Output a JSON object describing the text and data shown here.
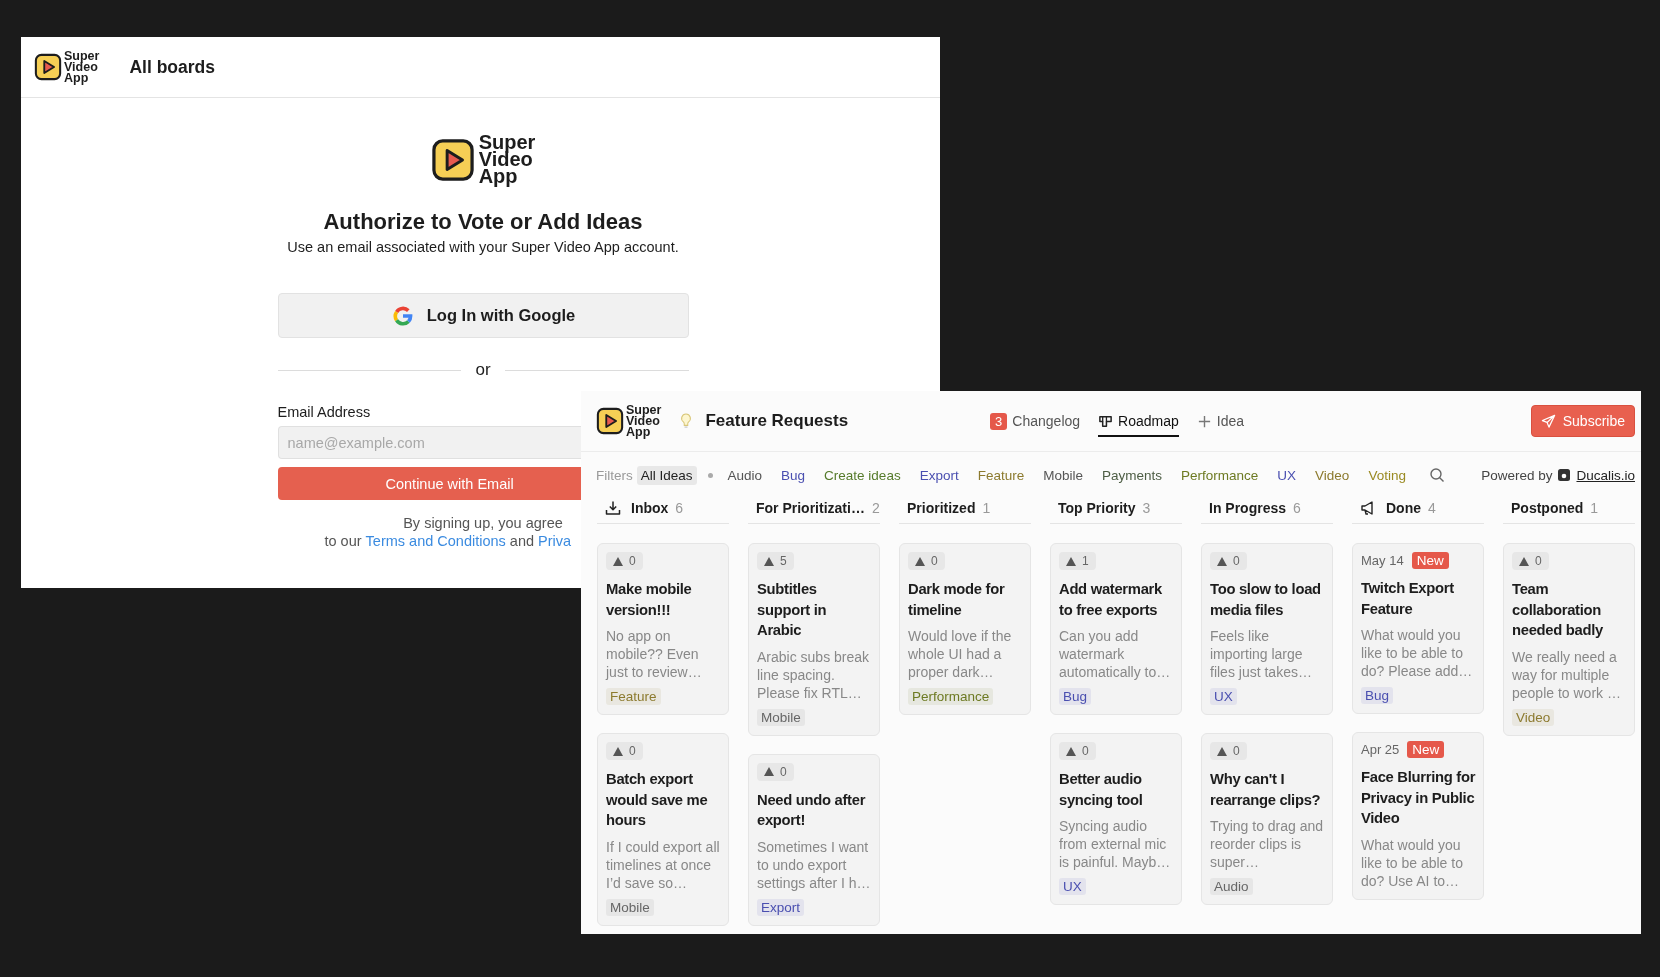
{
  "login_window": {
    "logo_text": "Super Video App",
    "title": "All boards",
    "hero_logo_text": "Super Video App",
    "heading": "Authorize to Vote or Add Ideas",
    "subheading": "Use an email associated with your Super Video App account.",
    "google_button": "Log In with Google",
    "divider": "or",
    "email_label": "Email Address",
    "email_placeholder": "name@example.com",
    "continue_button": "Continue with Email",
    "legal_line_1": "By signing up, you agree",
    "legal_line_2": {
      "prefix": "to our",
      "link": "Terms and Conditions",
      "middle": "and",
      "cut_link": "Priva"
    }
  },
  "board_window": {
    "logo_text": "Super Video App",
    "title": "Feature Requests",
    "nav": [
      {
        "label": "Changelog",
        "badge": "3",
        "selected": false
      },
      {
        "label": "Roadmap",
        "selected": true
      },
      {
        "label": "Idea",
        "selected": false
      }
    ],
    "subscribe_button": "Subscribe",
    "filters_label": "Filters",
    "filters": [
      {
        "label": "All Ideas",
        "selected": true,
        "color": "#222222"
      },
      {
        "label": "Audio",
        "selected": false,
        "color": "#555555"
      },
      {
        "label": "Bug",
        "selected": false,
        "color": "#4a4fb0"
      },
      {
        "label": "Create ideas",
        "selected": false,
        "color": "#557a2a"
      },
      {
        "label": "Export",
        "selected": false,
        "color": "#4a4fb0"
      },
      {
        "label": "Feature",
        "selected": false,
        "color": "#8c7a2e"
      },
      {
        "label": "Mobile",
        "selected": false,
        "color": "#555555"
      },
      {
        "label": "Payments",
        "selected": false,
        "color": "#4d5d44"
      },
      {
        "label": "Performance",
        "selected": false,
        "color": "#6d7a22"
      },
      {
        "label": "UX",
        "selected": false,
        "color": "#4a4fb0"
      },
      {
        "label": "Video",
        "selected": false,
        "color": "#8c7a2e"
      },
      {
        "label": "Voting",
        "selected": false,
        "color": "#9a8a22"
      }
    ],
    "powered_by": "Powered by",
    "powered_link": "Ducalis.io",
    "columns": [
      {
        "name": "Inbox",
        "count": "6",
        "cards": [
          {
            "kind": "idea",
            "votes": "0",
            "title": "Make mobile version!!!",
            "description": "No app on mobile?? Even just to review…",
            "tag": {
              "label": "Feature",
              "color": "#8c7a2e"
            }
          },
          {
            "kind": "idea",
            "votes": "0",
            "title": "Batch export would save me hours",
            "description": "If I could export all timelines at once I’d save so…",
            "tag": {
              "label": "Mobile",
              "color": "#666666"
            }
          }
        ]
      },
      {
        "name": "For Prioritizati…",
        "count": "2",
        "cards": [
          {
            "kind": "idea",
            "votes": "5",
            "title": "Subtitles support in Arabic",
            "description": "Arabic subs break line spacing. Please fix RTL…",
            "tag": {
              "label": "Mobile",
              "color": "#666666"
            }
          },
          {
            "kind": "idea",
            "votes": "0",
            "title": "Need undo after export!",
            "description": "Sometimes I want to undo export settings after I h…",
            "tag": {
              "label": "Export",
              "color": "#4a4fb0"
            }
          }
        ]
      },
      {
        "name": "Prioritized",
        "count": "1",
        "cards": [
          {
            "kind": "idea",
            "votes": "0",
            "title": "Dark mode for timeline",
            "description": "Would love if the whole UI had a proper dark…",
            "tag": {
              "label": "Performance",
              "color": "#6d7a22"
            }
          }
        ]
      },
      {
        "name": "Top Priority",
        "count": "3",
        "cards": [
          {
            "kind": "idea",
            "votes": "1",
            "title": "Add watermark to free exports",
            "description": "Can you add watermark automatically to…",
            "tag": {
              "label": "Bug",
              "color": "#4a4fb0"
            }
          },
          {
            "kind": "idea",
            "votes": "0",
            "title": "Better audio syncing tool",
            "description": "Syncing audio from external mic is painful. Mayb…",
            "tag": {
              "label": "UX",
              "color": "#4a4fb0"
            }
          }
        ]
      },
      {
        "name": "In Progress",
        "count": "6",
        "cards": [
          {
            "kind": "idea",
            "votes": "0",
            "title": "Too slow to load media files",
            "description": "Feels like importing large files just takes…",
            "tag": {
              "label": "UX",
              "color": "#4a4fb0"
            }
          },
          {
            "kind": "idea",
            "votes": "0",
            "title": "Why can't I rearrange clips?",
            "description": "Trying to drag and reorder clips is super…",
            "tag": {
              "label": "Audio",
              "color": "#666666"
            }
          }
        ]
      },
      {
        "name": "Done",
        "count": "4",
        "cards": [
          {
            "kind": "dated",
            "date": "May 14",
            "badge": "New",
            "title": "Twitch Export Feature",
            "description": "What would you like to be able to do? Please add…",
            "tag": {
              "label": "Bug",
              "color": "#4a4fb0"
            }
          },
          {
            "kind": "dated",
            "date": "Apr 25",
            "badge": "New",
            "title": "Face Blurring for Privacy in Public Video",
            "description": "What would you like to be able to do? Use AI to…"
          }
        ]
      },
      {
        "name": "Postponed",
        "count": "1",
        "cards": [
          {
            "kind": "idea",
            "votes": "0",
            "title": "Team collaboration needed badly",
            "description": "We really need a way for multiple people to work …",
            "tag": {
              "label": "Video",
              "color": "#8c7a2e"
            }
          }
        ]
      }
    ]
  }
}
